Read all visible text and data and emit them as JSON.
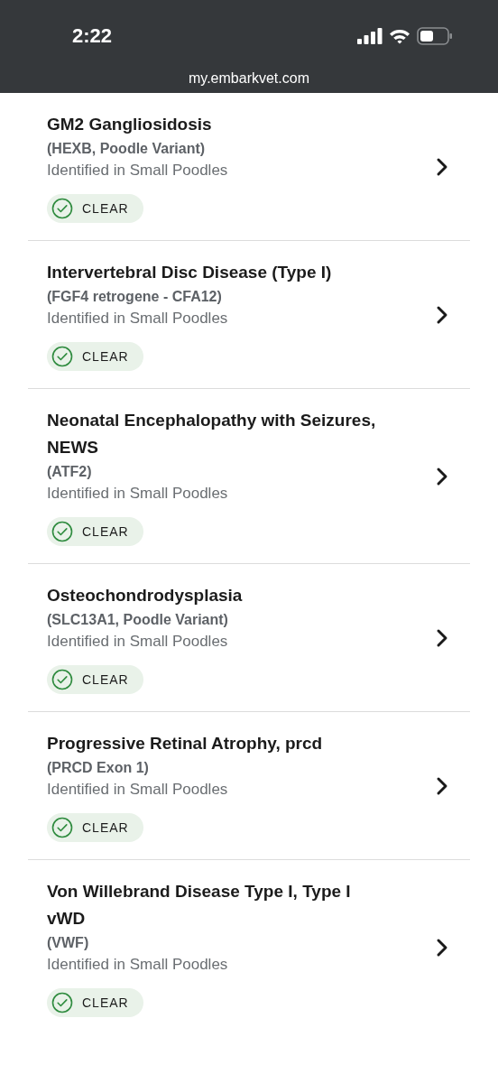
{
  "status_bar": {
    "time": "2:22"
  },
  "address_bar": {
    "url": "my.embarkvet.com"
  },
  "conditions": [
    {
      "title_lines": [
        "GM2 Gangliosidosis"
      ],
      "gene": "(HEXB, Poodle Variant)",
      "note": "Identified in Small Poodles",
      "result": {
        "kind": "clear",
        "label": "CLEAR"
      }
    },
    {
      "title_lines": [
        "Intervertebral Disc Disease (Type I)"
      ],
      "gene": "(FGF4 retrogene - CFA12)",
      "note": "Identified in Small Poodles",
      "result": {
        "kind": "clear",
        "label": "CLEAR"
      }
    },
    {
      "title_lines": [
        "Neonatal Encephalopathy with Seizures,",
        "NEWS"
      ],
      "gene": "(ATF2)",
      "note": "Identified in Small Poodles",
      "result": {
        "kind": "clear",
        "label": "CLEAR"
      }
    },
    {
      "title_lines": [
        "Osteochondrodysplasia"
      ],
      "gene": "(SLC13A1, Poodle Variant)",
      "note": "Identified in Small Poodles",
      "result": {
        "kind": "clear",
        "label": "CLEAR"
      }
    },
    {
      "title_lines": [
        "Progressive Retinal Atrophy, prcd"
      ],
      "gene": "(PRCD Exon 1)",
      "note": "Identified in Small Poodles",
      "result": {
        "kind": "clear",
        "label": "CLEAR"
      }
    },
    {
      "title_lines": [
        "Von Willebrand Disease Type I, Type I",
        "vWD"
      ],
      "gene": "(VWF)",
      "note": "Identified in Small Poodles",
      "result": {
        "kind": "clear",
        "label": "CLEAR"
      }
    }
  ]
}
